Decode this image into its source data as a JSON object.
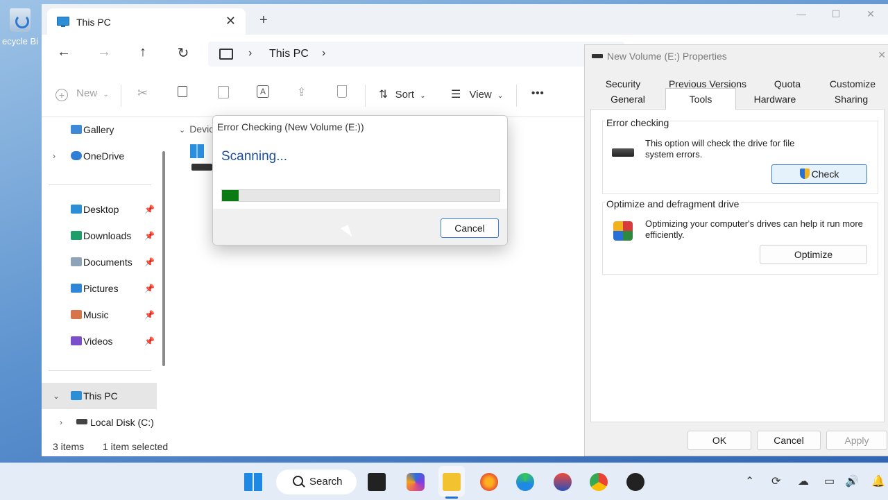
{
  "desktop": {
    "recycle_label": "ecycle Bi"
  },
  "explorer": {
    "tab_title": "This PC",
    "tab_close": "✕",
    "new_tab": "+",
    "window_controls": {
      "minimize": "—",
      "maximize": "☐",
      "close": "✕"
    },
    "nav": {
      "back": "←",
      "forward": "→",
      "up": "↑",
      "refresh": "↻"
    },
    "address": {
      "sep1": "›",
      "crumb": "This PC",
      "sep2": "›"
    },
    "toolbar": {
      "new_label": "New",
      "sort_label": "Sort",
      "view_label": "View",
      "more": "•••"
    },
    "sidebar": {
      "top_items": [
        {
          "label": "Gallery"
        },
        {
          "label": "OneDrive"
        }
      ],
      "pinned_items": [
        {
          "label": "Desktop"
        },
        {
          "label": "Downloads"
        },
        {
          "label": "Documents"
        },
        {
          "label": "Pictures"
        },
        {
          "label": "Music"
        },
        {
          "label": "Videos"
        }
      ],
      "this_pc": "This PC",
      "local_disk": "Local Disk (C:)"
    },
    "content_header": "Devic",
    "status": {
      "items": "3 items",
      "selected": "1 item selected"
    }
  },
  "error_dialog": {
    "title": "Error Checking (New Volume (E:))",
    "status": "Scanning...",
    "progress_percent": 6,
    "cancel_label": "Cancel"
  },
  "properties": {
    "title": "New Volume (E:) Properties",
    "close": "✕",
    "tabs_row1": [
      "Security",
      "Previous Versions",
      "Quota",
      "Customize"
    ],
    "tabs_row2": [
      "General",
      "Tools",
      "Hardware",
      "Sharing"
    ],
    "active_tab": "Tools",
    "error_checking": {
      "label": "Error checking",
      "text": "This option will check the drive for file system errors.",
      "button": "Check"
    },
    "optimize": {
      "label": "Optimize and defragment drive",
      "text": "Optimizing your computer's drives can help it run more efficiently.",
      "button": "Optimize"
    },
    "buttons": {
      "ok": "OK",
      "cancel": "Cancel",
      "apply": "Apply"
    }
  },
  "taskbar": {
    "search_label": "Search"
  },
  "colors": {
    "accent": "#0a7a12",
    "selection": "#e6e6e6",
    "focus": "#3a7bd5"
  }
}
